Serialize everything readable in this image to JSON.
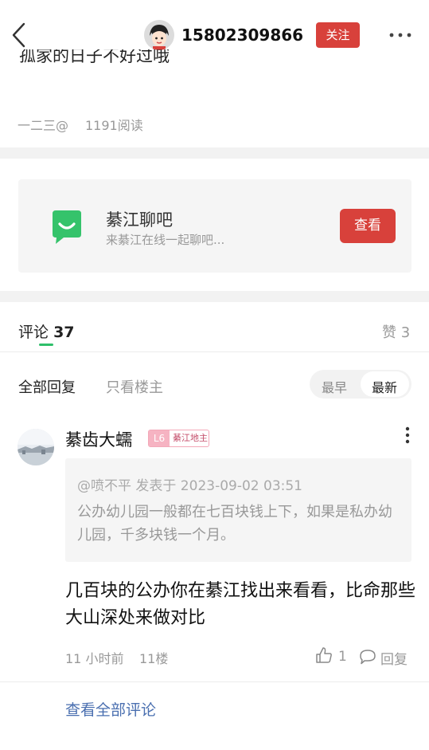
{
  "header": {
    "username": "15802309866",
    "follow_label": "关注"
  },
  "post": {
    "cutoff_text": "孤家的日子不好过哦",
    "author": "一二三@",
    "reads": "1191阅读"
  },
  "group_card": {
    "title": "綦江聊吧",
    "subtitle": "来綦江在线一起聊吧...",
    "button_label": "查看"
  },
  "tabs": {
    "comments_label": "评论",
    "comments_count": "37",
    "likes_label": "赞 3"
  },
  "filters": {
    "all_replies": "全部回复",
    "owner_only": "只看楼主",
    "sort_early": "最早",
    "sort_new": "最新"
  },
  "comment": {
    "name": "綦齿大蠕",
    "level": "L6",
    "level_title": "綦江地主",
    "quote_head": "@喷不平 发表于 2023-09-02 03:51",
    "quote_body": "公办幼儿园一般都在七百块钱上下，如果是私办幼儿园，千多块钱一个月。",
    "body": "几百块的公办你在綦江找出来看看，比命那些大山深处来做对比",
    "time": "11 小时前",
    "floor": "11楼",
    "likes": "1",
    "reply_label": "回复"
  },
  "footer": {
    "view_all": "查看全部评论"
  },
  "colors": {
    "accent_red": "#d8413b",
    "tab_green": "#2fbf6a",
    "link_blue": "#4a6fb0"
  },
  "icons": [
    "back-icon",
    "avatar",
    "more-icon",
    "chat-app-icon",
    "like-icon",
    "reply-icon",
    "kebab-menu-icon"
  ]
}
